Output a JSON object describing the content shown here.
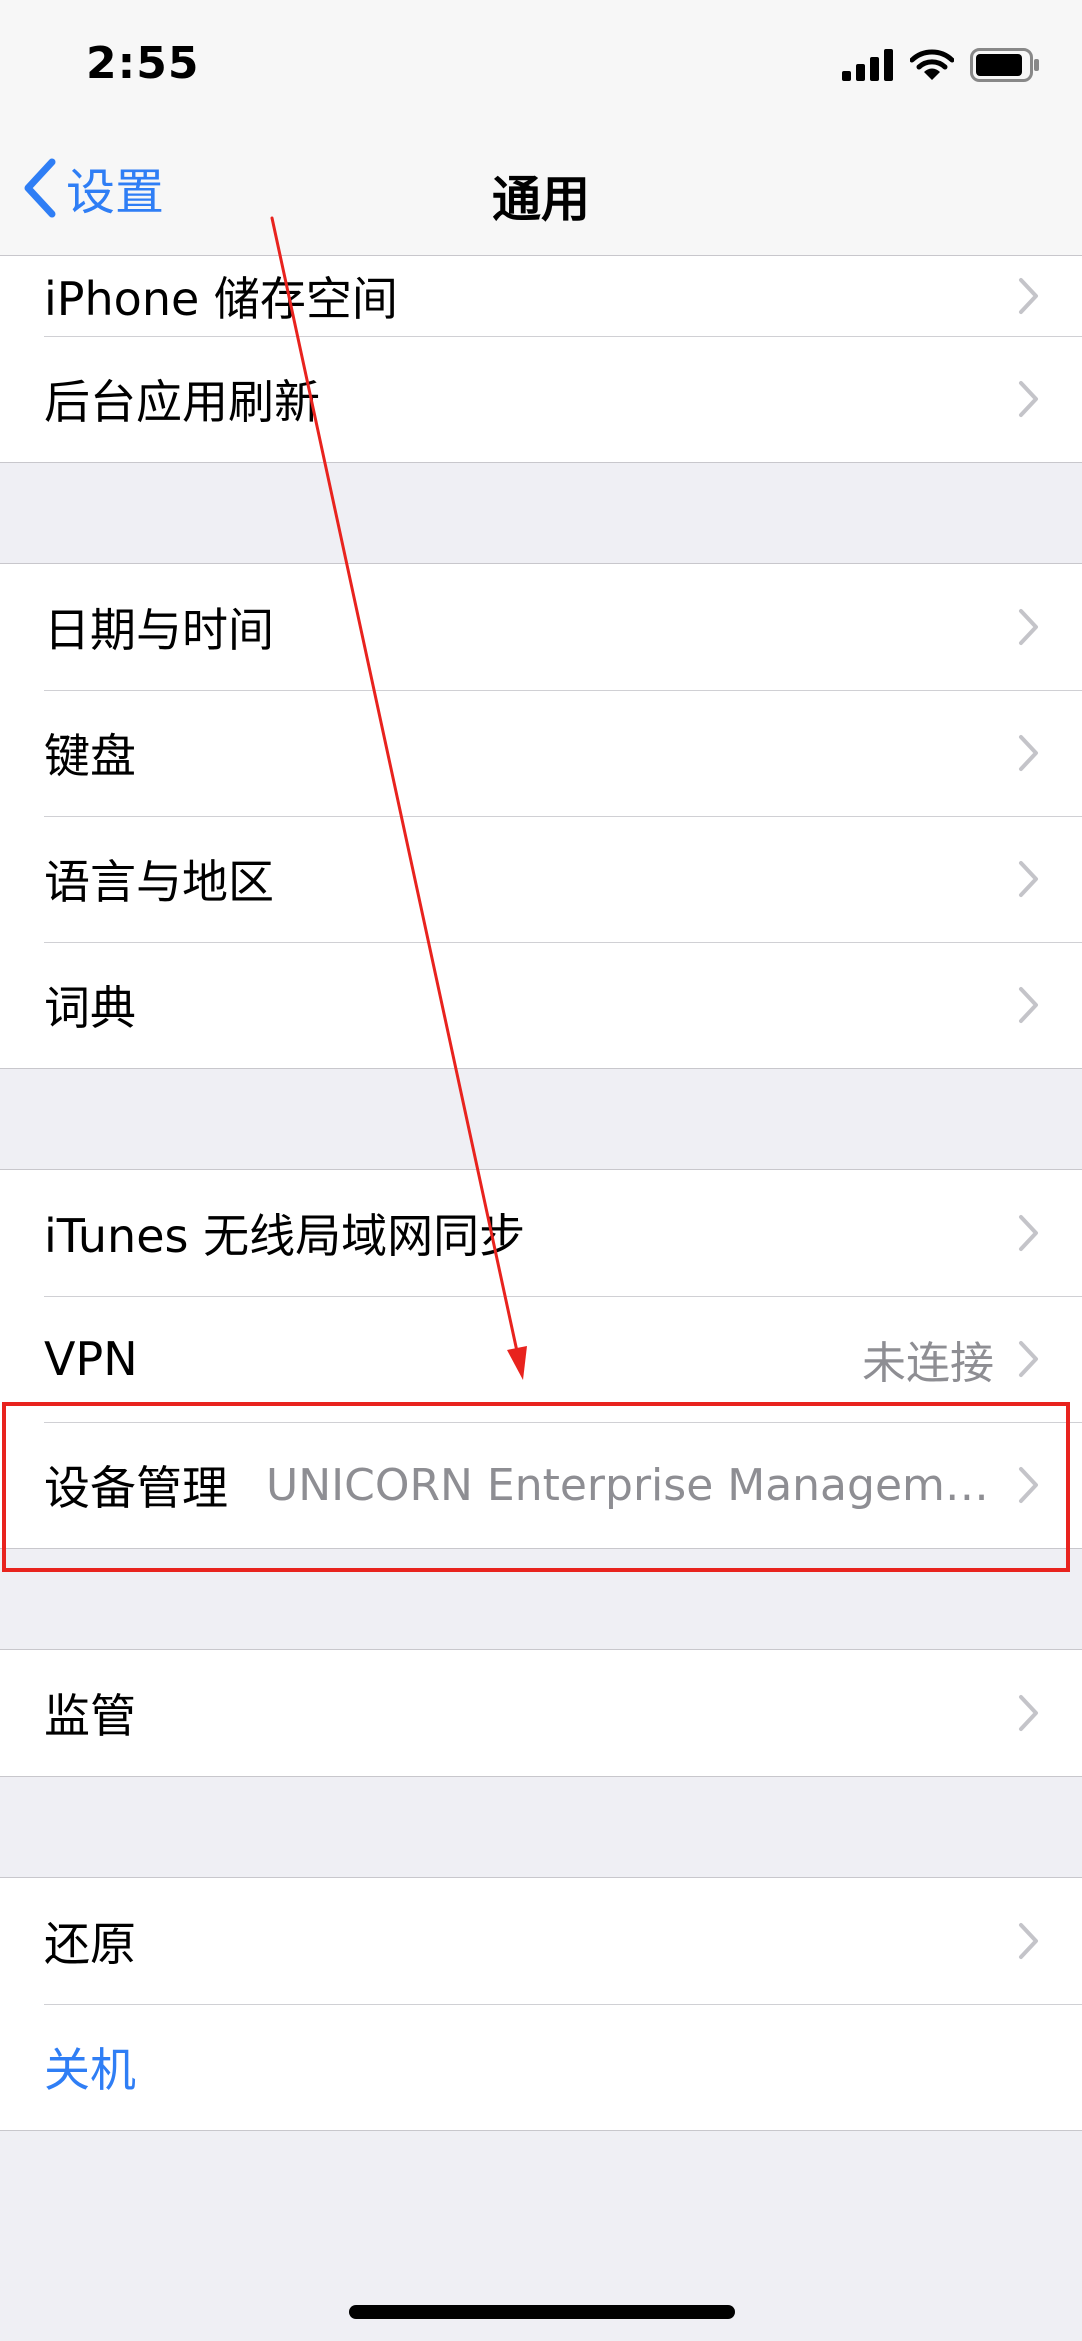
{
  "status_bar": {
    "time": "2:55"
  },
  "nav": {
    "back_label": "设置",
    "title": "通用"
  },
  "groups": [
    {
      "items": [
        {
          "label": "iPhone 储存空间",
          "value": ""
        },
        {
          "label": "后台应用刷新",
          "value": ""
        }
      ]
    },
    {
      "items": [
        {
          "label": "日期与时间",
          "value": ""
        },
        {
          "label": "键盘",
          "value": ""
        },
        {
          "label": "语言与地区",
          "value": ""
        },
        {
          "label": "词典",
          "value": ""
        }
      ]
    },
    {
      "items": [
        {
          "label": "iTunes 无线局域网同步",
          "value": ""
        },
        {
          "label": "VPN",
          "value": "未连接"
        },
        {
          "label": "设备管理",
          "value": "UNICORN Enterprise Manageme..."
        }
      ]
    },
    {
      "items": [
        {
          "label": "监管",
          "value": ""
        }
      ]
    },
    {
      "items": [
        {
          "label": "还原",
          "value": ""
        },
        {
          "label": "关机",
          "value": ""
        }
      ]
    }
  ],
  "colors": {
    "accent": "#2f7ef5",
    "annotation": "#e8231e",
    "background": "#efeff4",
    "secondary_text": "#8e8e93"
  },
  "icons": {
    "back": "chevron-left-icon",
    "disclosure": "chevron-right-icon",
    "signal": "cellular-signal-icon",
    "wifi": "wifi-icon",
    "battery": "battery-icon"
  }
}
